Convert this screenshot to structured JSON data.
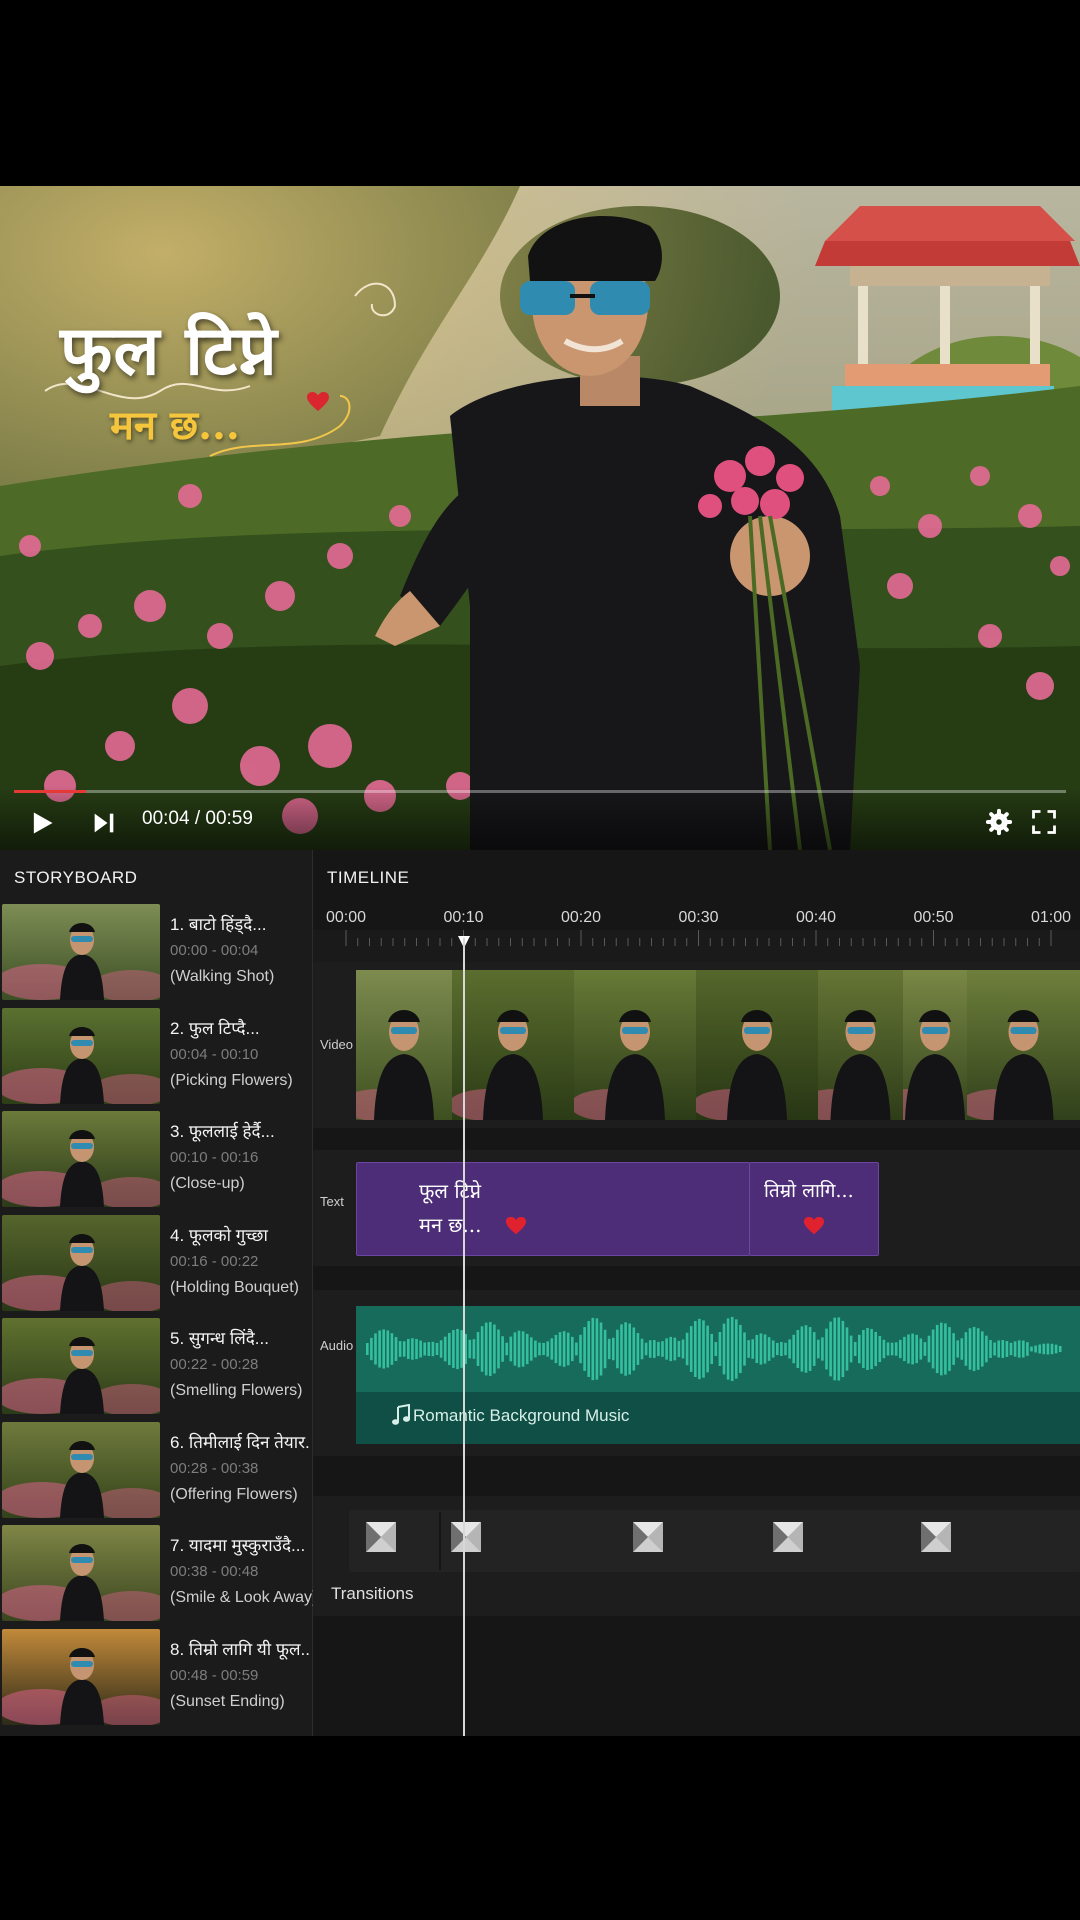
{
  "player": {
    "overlay_title_line1": "फुल टिप्ने",
    "overlay_title_line2": "मन छ...",
    "time_current": "00:04",
    "time_total": "00:59",
    "time_separator": " / ",
    "progress_fraction": 0.068,
    "controls": [
      "play-icon",
      "skip-next-icon",
      "gear-icon",
      "fullscreen-icon"
    ]
  },
  "storyboard": {
    "header": "STORYBOARD",
    "items": [
      {
        "title": "1. बाटो हिंड्दै...",
        "time": "00:00 - 00:04",
        "desc": "(Walking Shot)"
      },
      {
        "title": "2. फुल टिप्दै...",
        "time": "00:04 - 00:10",
        "desc": "(Picking Flowers)"
      },
      {
        "title": "3. फूललाई हेर्दै...",
        "time": "00:10 - 00:16",
        "desc": "(Close-up)"
      },
      {
        "title": "4. फूलको गुच्छा",
        "time": "00:16 - 00:22",
        "desc": "(Holding Bouquet)"
      },
      {
        "title": "5. सुगन्ध लिंदै...",
        "time": "00:22 - 00:28",
        "desc": "(Smelling Flowers)"
      },
      {
        "title": "6. तिमीलाई दिन तेयार...",
        "time": "00:28 - 00:38",
        "desc": "(Offering Flowers)"
      },
      {
        "title": "7. यादमा मुस्कुराउँदै...",
        "time": "00:38 - 00:48",
        "desc": "(Smile & Look Away)"
      },
      {
        "title": "8. तिम्रो लागि यी फूल...",
        "time": "00:48 - 00:59",
        "desc": "(Sunset Ending)"
      }
    ]
  },
  "timeline": {
    "header": "TIMELINE",
    "ticks": [
      "00:00",
      "00:10",
      "00:20",
      "00:30",
      "00:40",
      "00:50",
      "01:00"
    ],
    "tracks": {
      "video": "Video",
      "text": "Text",
      "audio": "Audio"
    },
    "text_clips": [
      {
        "line1": "फूल टिप्ने",
        "line2": "मन छ..."
      },
      {
        "line1": "तिम्रो लागि..."
      }
    ],
    "audio_name": "Romantic Background Music",
    "transitions_label": "Transitions",
    "playhead_time": "00:10"
  },
  "colors": {
    "accent_red": "#e53935",
    "text_clip": "#4d2d78",
    "audio_clip": "#0f4f45",
    "waveform": "#2fb497",
    "title_yellow": "#f5c63c"
  }
}
